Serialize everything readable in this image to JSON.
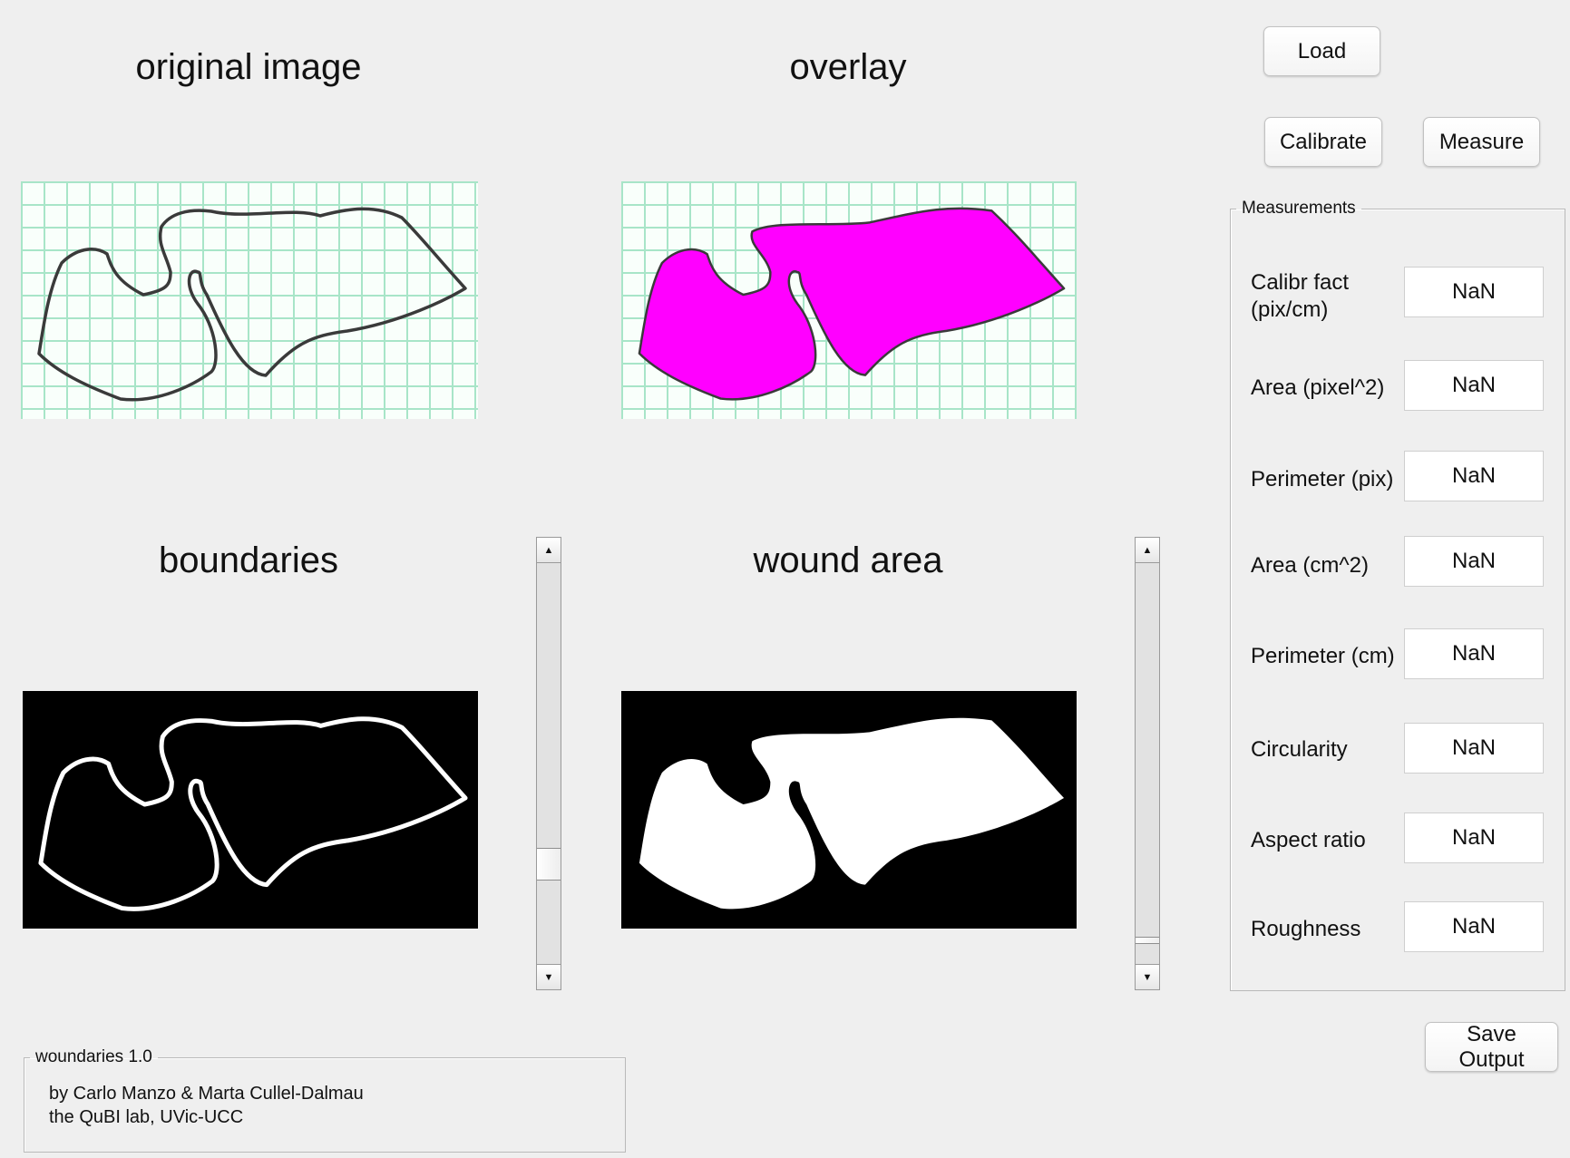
{
  "panels": {
    "original": {
      "title": "original image"
    },
    "overlay": {
      "title": "overlay"
    },
    "boundaries": {
      "title": "boundaries"
    },
    "wound": {
      "title": "wound area"
    }
  },
  "buttons": {
    "load": "Load",
    "calibrate": "Calibrate",
    "measure": "Measure",
    "save": "Save Output"
  },
  "measurements": {
    "legend": "Measurements",
    "rows": [
      {
        "label": "Calibr fact (pix/cm)",
        "value": "NaN"
      },
      {
        "label": "Area (pixel^2)",
        "value": "NaN"
      },
      {
        "label": "Perimeter (pix)",
        "value": "NaN"
      },
      {
        "label": "Area (cm^2)",
        "value": "NaN"
      },
      {
        "label": "Perimeter (cm)",
        "value": "NaN"
      },
      {
        "label": "Circularity",
        "value": "NaN"
      },
      {
        "label": "Aspect ratio",
        "value": "NaN"
      },
      {
        "label": "Roughness",
        "value": "NaN"
      }
    ]
  },
  "about": {
    "legend": "woundaries 1.0",
    "line1": "by Carlo Manzo & Marta Cullel-Dalmau",
    "line2": "the QuBI lab, UVic-UCC"
  },
  "colors": {
    "overlay_fill": "#ff00ff",
    "grid_line": "#a8e5c8",
    "outline": "#3a3a3a"
  },
  "scrollbars": {
    "boundaries_position": 0.75,
    "wound_position": 1.0
  }
}
